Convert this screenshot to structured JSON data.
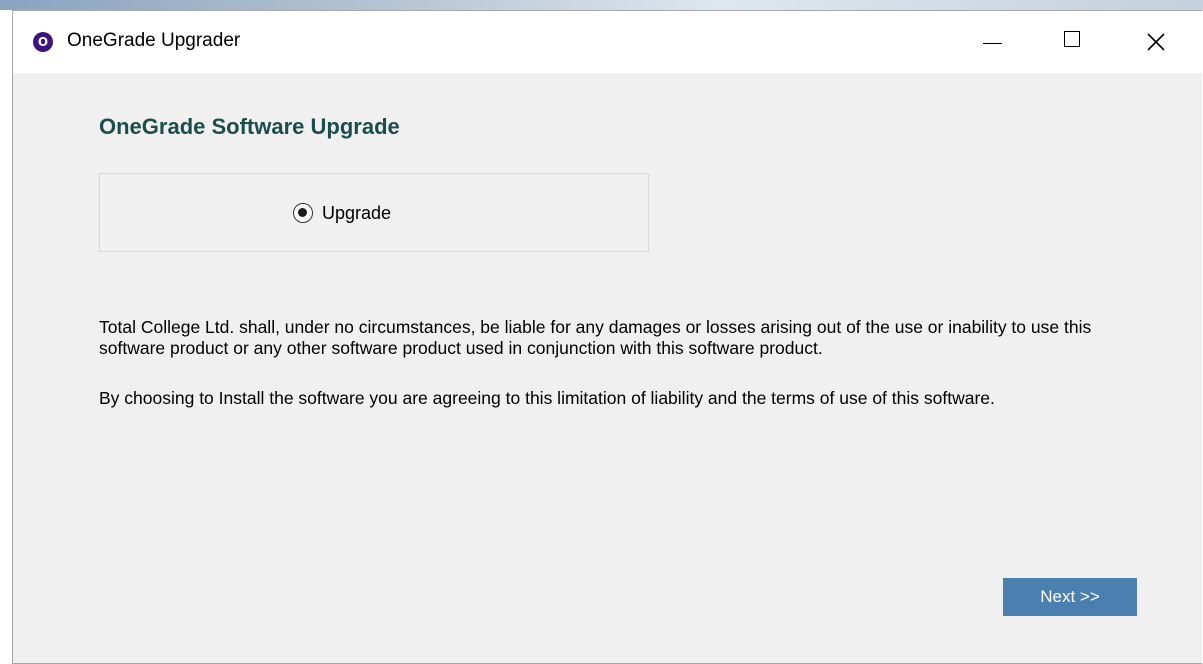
{
  "window": {
    "title": "OneGrade Upgrader",
    "icon": "onegrade-app-icon",
    "icon_letter": "O",
    "controls": {
      "minimize_icon": "minimize-icon",
      "maximize_icon": "maximize-icon",
      "close_icon": "close-icon"
    }
  },
  "main": {
    "heading": "OneGrade Software Upgrade",
    "options": {
      "selected": "Upgrade",
      "items": [
        {
          "label": "Upgrade",
          "checked": true
        }
      ]
    },
    "disclaimer": "Total College Ltd. shall, under no circumstances, be liable for any damages or losses arising out of the use or inability to use this software product or any other software product used in conjunction with this software product.",
    "agreement": "By choosing to Install the software you are agreeing to this limitation of liability and the terms of use of this software."
  },
  "footer": {
    "next_label": "Next >>"
  },
  "colors": {
    "heading": "#1b4e4b",
    "button": "#4a7fb0",
    "window_bg": "#f0f0f0",
    "app_icon": "#3d1480"
  }
}
